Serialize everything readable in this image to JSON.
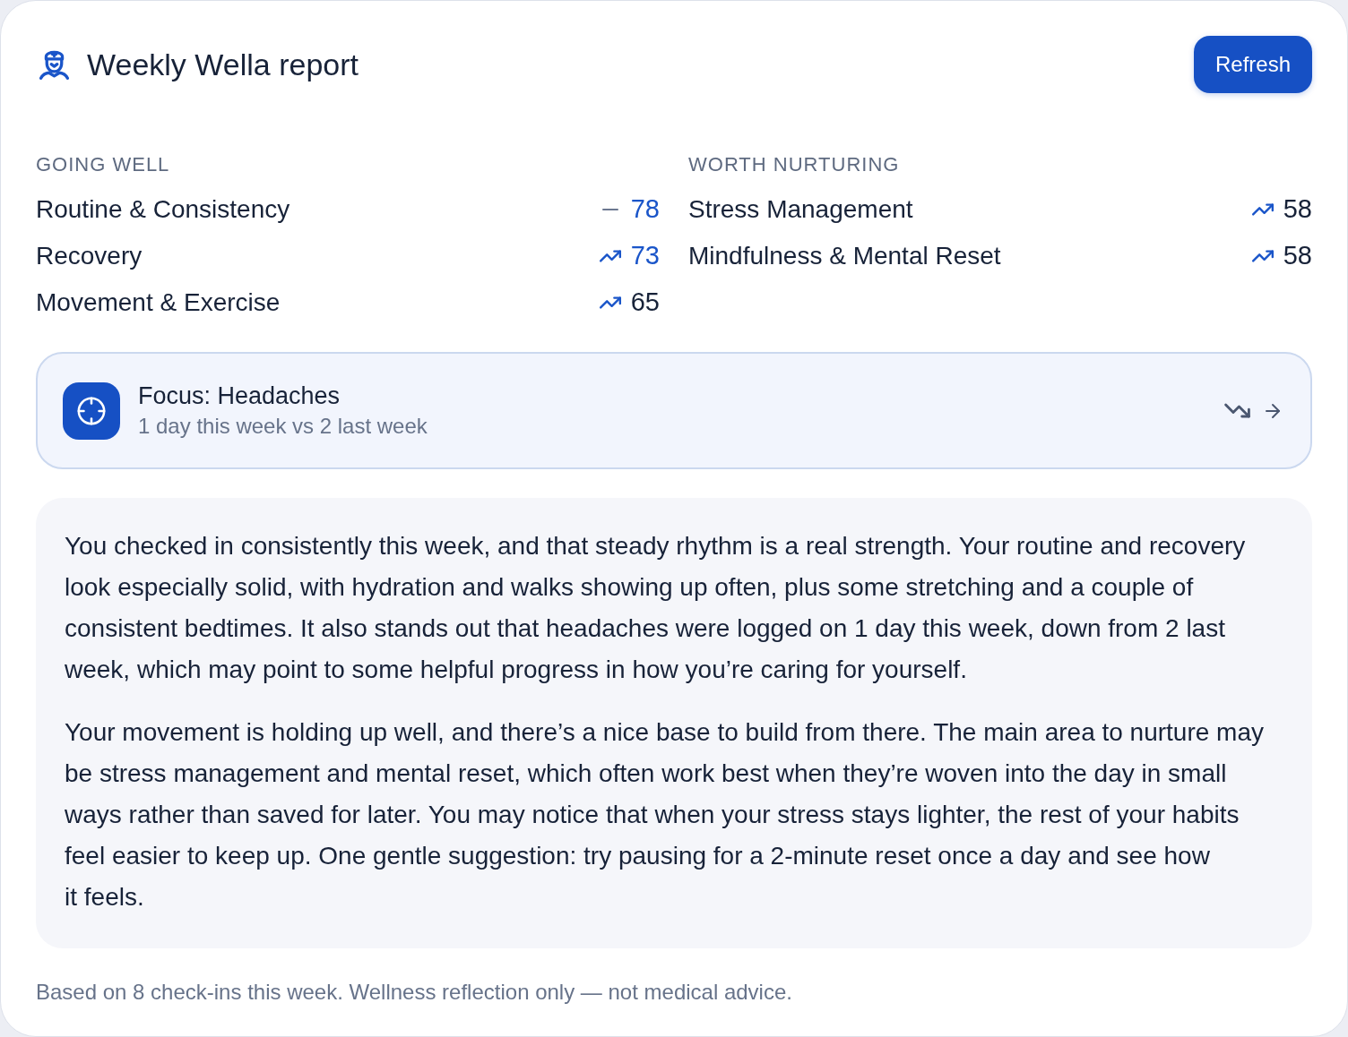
{
  "header": {
    "title": "Weekly Wella report",
    "refresh_button": "Refresh"
  },
  "groups": [
    {
      "heading": "GOING WELL",
      "items": [
        {
          "name": "Routine & Consistency",
          "kind": "flat",
          "score": "78",
          "highlighted": true
        },
        {
          "name": "Recovery",
          "kind": "up",
          "score": "73",
          "highlighted": true
        },
        {
          "name": "Movement & Exercise",
          "kind": "up",
          "score": "65",
          "highlighted": false
        }
      ]
    },
    {
      "heading": "WORTH NURTURING",
      "items": [
        {
          "name": "Stress Management",
          "kind": "up",
          "score": "58",
          "highlighted": false
        },
        {
          "name": "Mindfulness & Mental Reset",
          "kind": "up",
          "score": "58",
          "highlighted": false
        }
      ]
    }
  ],
  "focus": {
    "title": "Focus: Headaches",
    "subtitle": "1 day this week vs 2 last week"
  },
  "summary": [
    "You checked in consistently this week, and that steady rhythm is a real strength. Your routine and recovery look especially solid, with hydration and walks showing up often, plus some stretching and a couple of consistent bedtimes. It also stands out that headaches were logged on 1 day this week, down from 2 last week, which may point to some helpful progress in how you’re caring for yourself.",
    "Your movement is holding up well, and there’s a nice base to build from there. The main area to nurture may be stress management and mental reset, which often work best when they’re woven into the day in small ways rather than saved for later. You may notice that when your stress stays lighter, the rest of your habits feel easier to keep up. One gentle suggestion: try pausing for a 2-minute reset once a day and see how it feels."
  ],
  "footer": "Based on 8 check-ins this week. Wellness reflection only — not medical advice."
}
